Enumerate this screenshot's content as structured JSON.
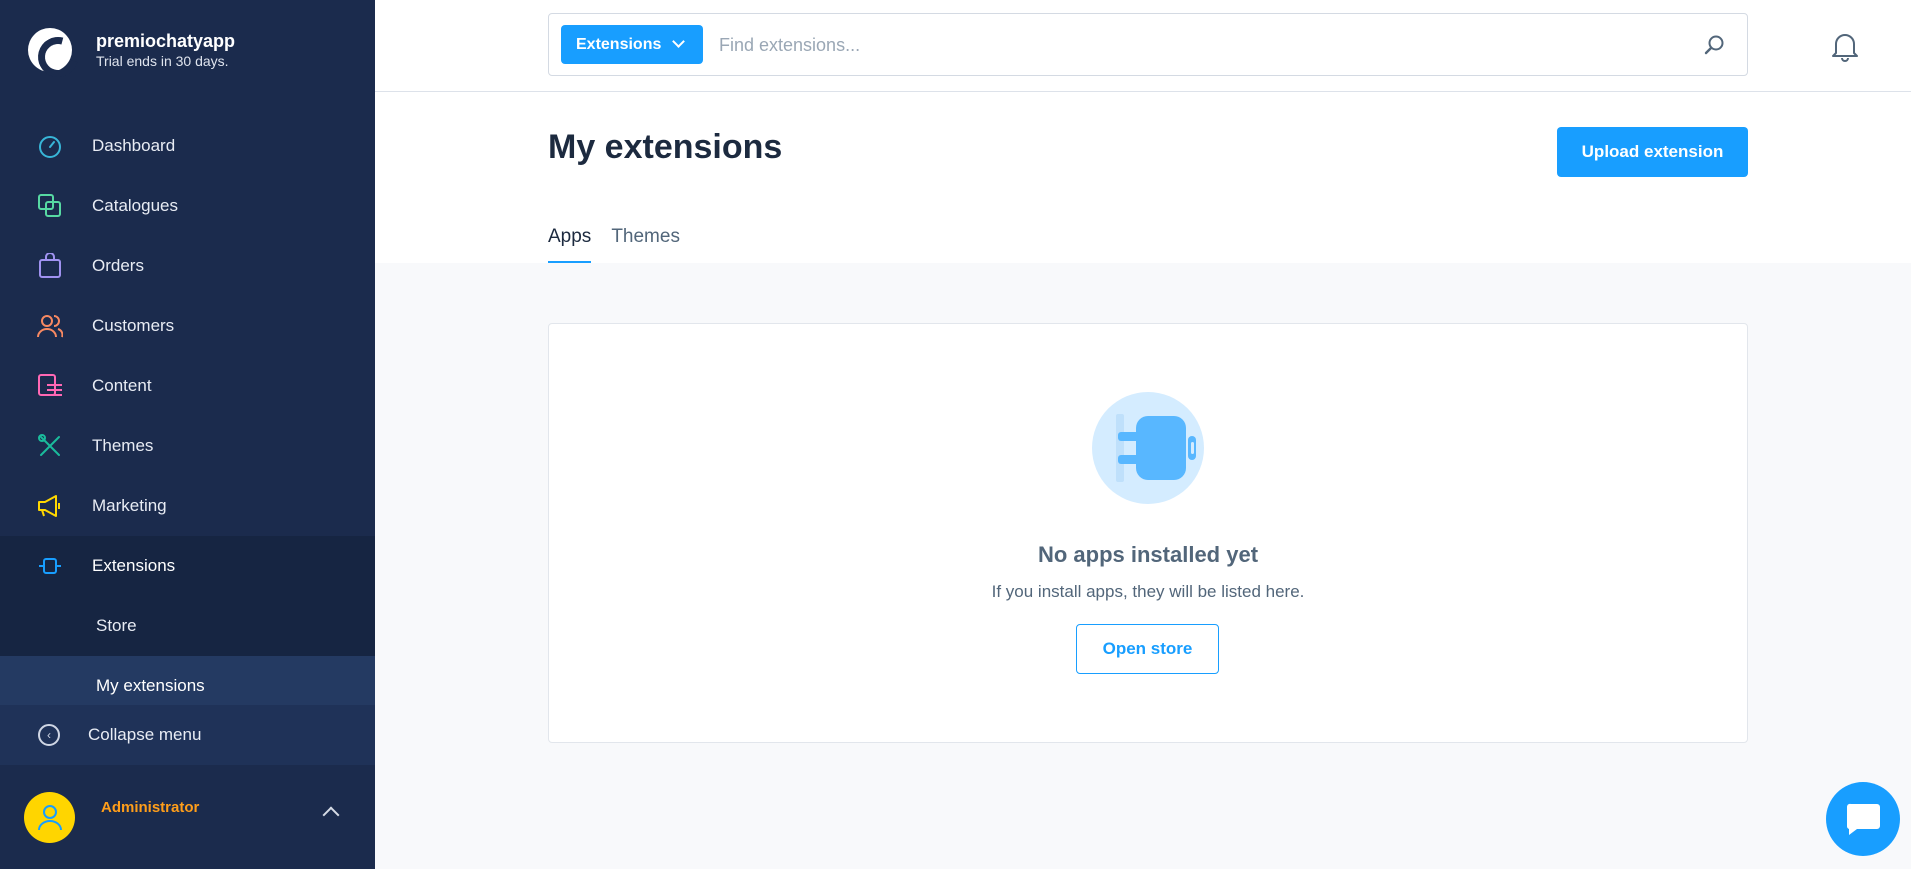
{
  "brand": {
    "name": "premiochatyapp",
    "subtitle": "Trial ends in 30 days."
  },
  "sidebar": {
    "items": [
      {
        "label": "Dashboard",
        "icon": "dashboard-icon",
        "color": "#38b6d8"
      },
      {
        "label": "Catalogues",
        "icon": "catalogues-icon",
        "color": "#57d9a3"
      },
      {
        "label": "Orders",
        "icon": "orders-icon",
        "color": "#a092f0"
      },
      {
        "label": "Customers",
        "icon": "customers-icon",
        "color": "#f88962"
      },
      {
        "label": "Content",
        "icon": "content-icon",
        "color": "#ff68b4"
      },
      {
        "label": "Themes",
        "icon": "themes-icon",
        "color": "#1abc9c"
      },
      {
        "label": "Marketing",
        "icon": "marketing-icon",
        "color": "#ffd700"
      },
      {
        "label": "Extensions",
        "icon": "extensions-icon",
        "color": "#189eff"
      }
    ],
    "sub_items": [
      {
        "label": "Store"
      },
      {
        "label": "My extensions"
      }
    ],
    "collapse_label": "Collapse menu"
  },
  "user": {
    "name": "Administrator"
  },
  "search": {
    "scope_label": "Extensions",
    "placeholder": "Find extensions..."
  },
  "header": {
    "title": "My extensions",
    "upload_label": "Upload extension",
    "tabs": [
      {
        "label": "Apps",
        "active": true
      },
      {
        "label": "Themes",
        "active": false
      }
    ]
  },
  "empty_state": {
    "title": "No apps installed yet",
    "text": "If you install apps, they will be listed here.",
    "button_label": "Open store"
  },
  "colors": {
    "accent": "#189eff",
    "sidebar_bg": "#1b2b4d",
    "user_name": "#ff9e1a"
  }
}
